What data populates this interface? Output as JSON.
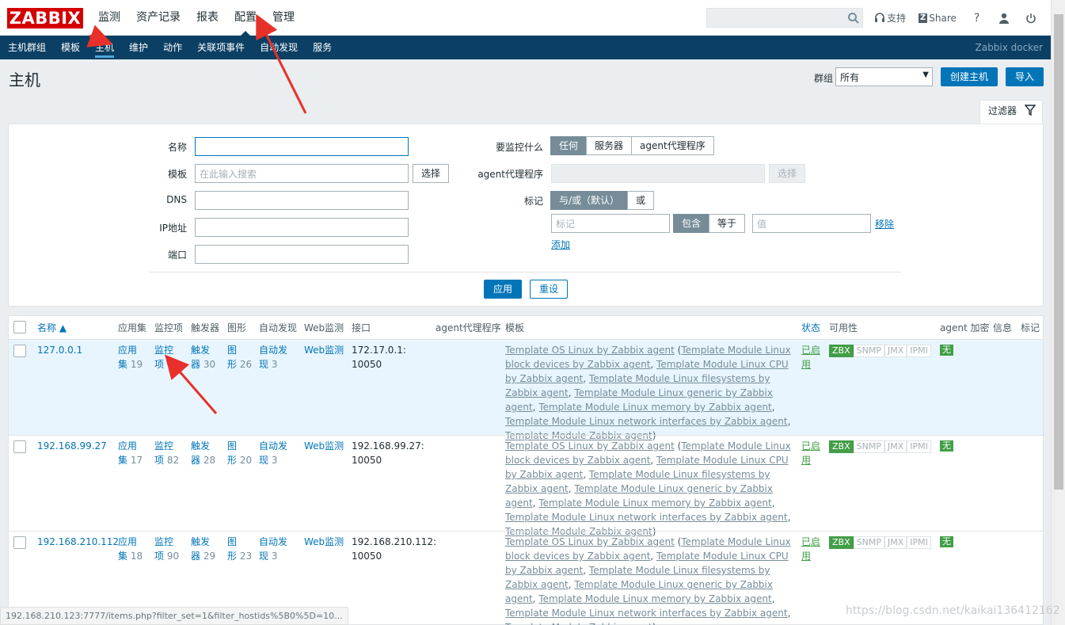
{
  "app": {
    "logo": "ZABBIX",
    "main_menu": [
      "监测",
      "资产记录",
      "报表",
      "配置",
      "管理"
    ],
    "active_main": "配置",
    "top_icons": {
      "support": "支持",
      "share": "Share",
      "help": "?"
    },
    "sub_menu": [
      "主机群组",
      "模板",
      "主机",
      "维护",
      "动作",
      "关联项事件",
      "自动发现",
      "服务"
    ],
    "active_sub": "主机",
    "server_name": "Zabbix docker"
  },
  "header": {
    "title": "主机",
    "group_label": "群组",
    "group_value": "所有",
    "create_button": "创建主机",
    "import_button": "导入"
  },
  "filter": {
    "tab_label": "过滤器",
    "name_label": "名称",
    "name_value": "",
    "template_label": "模板",
    "template_placeholder": "在此输入搜索",
    "select_button": "选择",
    "dns_label": "DNS",
    "ip_label": "IP地址",
    "port_label": "端口",
    "monitored_by_label": "要监控什么",
    "monitored_by_options": [
      "任何",
      "服务器",
      "agent代理程序"
    ],
    "monitored_by_selected": "任何",
    "proxy_label": "agent代理程序",
    "proxy_select_button": "选择",
    "tags_label": "标记",
    "tags_mode_options": [
      "与/或（默认）",
      "或"
    ],
    "tag_placeholder": "标记",
    "tag_op_options": [
      "包含",
      "等于"
    ],
    "value_placeholder": "值",
    "remove_link": "移除",
    "add_link": "添加",
    "apply_button": "应用",
    "reset_button": "重设"
  },
  "table": {
    "columns": [
      "名称 ▲",
      "应用集",
      "监控项",
      "触发器",
      "图形",
      "自动发现",
      "Web监测",
      "接口",
      "agent代理程序",
      "模板",
      "状态",
      "可用性",
      "agent 加密",
      "信息",
      "标记"
    ],
    "rows": [
      {
        "name": "127.0.0.1",
        "apps_1": "应用",
        "apps_2": "集",
        "apps_n": "19",
        "items_1": "监控",
        "items_2": "项",
        "items_n": "",
        "triggers_1": "触发",
        "triggers_2": "器",
        "triggers_n": "30",
        "graphs_1": "图",
        "graphs_2": "形",
        "graphs_n": "26",
        "disc_1": "自动发",
        "disc_2": "现",
        "disc_n": "3",
        "web": "Web监测",
        "iface_1": "172.17.0.1:",
        "iface_2": "10050",
        "status_1": "已启",
        "status_2": "用",
        "avail": [
          "ZBX",
          "SNMP",
          "JMX",
          "IPMI"
        ],
        "enc": "无"
      },
      {
        "name": "192.168.99.27",
        "apps_1": "应用",
        "apps_2": "集",
        "apps_n": "17",
        "items_1": "监控",
        "items_2": "项",
        "items_n": "82",
        "triggers_1": "触发",
        "triggers_2": "器",
        "triggers_n": "28",
        "graphs_1": "图",
        "graphs_2": "形",
        "graphs_n": "20",
        "disc_1": "自动发",
        "disc_2": "现",
        "disc_n": "3",
        "web": "Web监测",
        "iface_1": "192.168.99.27:",
        "iface_2": "10050",
        "status_1": "已启",
        "status_2": "用",
        "avail": [
          "ZBX",
          "SNMP",
          "JMX",
          "IPMI"
        ],
        "enc": "无"
      },
      {
        "name": "192.168.210.112",
        "apps_1": "应用",
        "apps_2": "集",
        "apps_n": "18",
        "items_1": "监控",
        "items_2": "项",
        "items_n": "90",
        "triggers_1": "触发",
        "triggers_2": "器",
        "triggers_n": "29",
        "graphs_1": "图",
        "graphs_2": "形",
        "graphs_n": "23",
        "disc_1": "自动发",
        "disc_2": "现",
        "disc_n": "3",
        "web": "Web监测",
        "iface_1": "192.168.210.112:",
        "iface_2": "10050",
        "status_1": "已启",
        "status_2": "用",
        "avail": [
          "ZBX",
          "SNMP",
          "JMX",
          "IPMI"
        ],
        "enc": "无"
      }
    ],
    "template_parts": [
      {
        "t": "Template OS Linux by Zabbix agent",
        "u": true
      },
      {
        "t": " (",
        "u": false
      },
      {
        "t": "Template Module Linux block devices by Zabbix agent",
        "u": true
      },
      {
        "t": ", ",
        "u": false
      },
      {
        "t": "Template Module Linux CPU by Zabbix agent",
        "u": true
      },
      {
        "t": ", ",
        "u": false
      },
      {
        "t": "Template Module Linux filesystems by Zabbix agent",
        "u": true
      },
      {
        "t": ", ",
        "u": false
      },
      {
        "t": "Template Module Linux generic by Zabbix agent",
        "u": true
      },
      {
        "t": ", ",
        "u": false
      },
      {
        "t": "Template Module Linux memory by Zabbix agent",
        "u": true
      },
      {
        "t": ", ",
        "u": false
      },
      {
        "t": "Template Module Linux network interfaces by Zabbix agent",
        "u": true
      },
      {
        "t": ", ",
        "u": false
      },
      {
        "t": "Template Module Zabbix agent",
        "u": true
      },
      {
        "t": ")",
        "u": false
      }
    ]
  },
  "status_bar_url": "192.168.210.123:7777/items.php?filter_set=1&filter_hostids%5B0%5D=10...",
  "watermark": "https://blog.csdn.net/kaikai136412162",
  "colors": {
    "brand": "#d40000",
    "nav": "#0b3f63",
    "link": "#0275b8",
    "ok": "#429e47",
    "annotation": "#e8302a"
  }
}
